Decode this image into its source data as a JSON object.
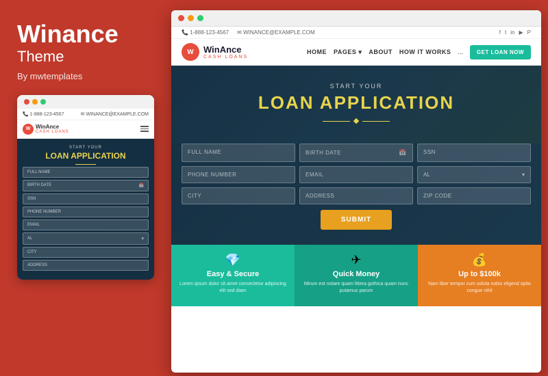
{
  "left": {
    "title": "Winance",
    "subtitle": "Theme",
    "by": "By mwtemplates",
    "mobile_preview": {
      "phone": "1-888-123-4567",
      "email": "WINANCE@EXAMPLE.COM",
      "logo_letter": "W",
      "logo_text": "WinAnce",
      "logo_sub": "CASH LOANS",
      "hero_pretitle": "START YOUR",
      "hero_title": "LOAN APPLICATION",
      "fields": [
        "FULL NAME",
        "BIRTH DATE",
        "SSN",
        "PHONE NUMBER",
        "EMAIL",
        "AL",
        "CITY",
        "ADDRESS"
      ]
    }
  },
  "right": {
    "browser": {
      "dots": [
        "red",
        "yellow",
        "green"
      ]
    },
    "topbar": {
      "phone": "1-888-123-4567",
      "phone_icon": "📞",
      "email": "WINANCE@EXAMPLE.COM",
      "email_icon": "✉"
    },
    "nav": {
      "logo_letter": "W",
      "logo_main": "WinAnce",
      "logo_sub": "CASH LOANS",
      "links": [
        "HOME",
        "PAGES",
        "ABOUT",
        "HOW IT WORKS",
        "..."
      ],
      "cta": "GET LOAN NOW"
    },
    "hero": {
      "pretitle": "START YOUR",
      "title": "LOAN APPLICATION"
    },
    "form": {
      "fields_row1": [
        "FULL NAME",
        "BIRTH DATE",
        "SSN"
      ],
      "fields_row2": [
        "PHONE NUMBER",
        "EMAIL",
        "AL"
      ],
      "fields_row3": [
        "CITY",
        "ADDRESS",
        "ZIP CODE"
      ],
      "submit": "SUBMIT"
    },
    "features": [
      {
        "icon": "💎",
        "title": "Easy & Secure",
        "text": "Lorem ipsum dolor sit amet consectetur adipiscing elit sed diam"
      },
      {
        "icon": "✈",
        "title": "Quick Money",
        "text": "Mirum est notare quam littera gothica quam nunc putamus parum"
      },
      {
        "icon": "💰",
        "title": "Up to $100k",
        "text": "Nam liber tempor cum soluta nobis eligend optio congue nihil"
      }
    ]
  }
}
